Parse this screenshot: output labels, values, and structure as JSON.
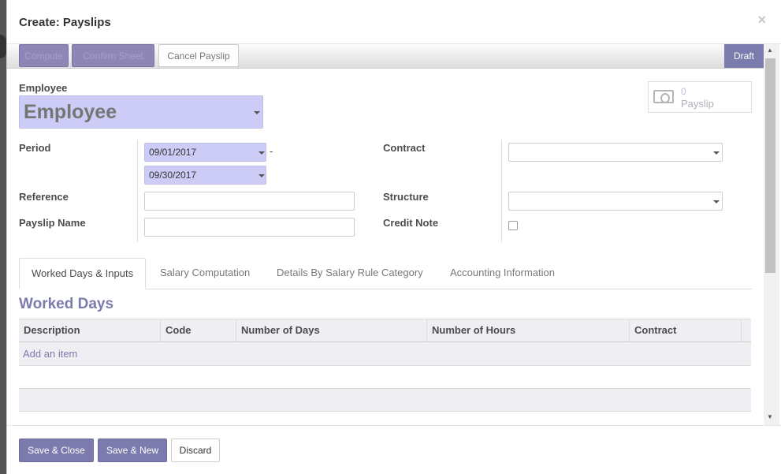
{
  "modal": {
    "title": "Create: Payslips",
    "close_glyph": "×"
  },
  "statusbar": {
    "buttons": [
      {
        "label": "Compute",
        "style": "primary"
      },
      {
        "label": "Confirm Sheet",
        "style": "primary"
      },
      {
        "label": "Cancel Payslip",
        "style": "default"
      }
    ],
    "status": "Draft"
  },
  "smart_button": {
    "icon": "money-icon",
    "count": "0",
    "label": "Payslip"
  },
  "form": {
    "employee_label": "Employee",
    "employee_value": "Employee",
    "period_label": "Period",
    "date_from": "09/01/2017",
    "date_sep": "-",
    "date_to": "09/30/2017",
    "reference_label": "Reference",
    "reference_value": "",
    "payslip_name_label": "Payslip Name",
    "payslip_name_value": "",
    "contract_label": "Contract",
    "contract_value": "",
    "structure_label": "Structure",
    "structure_value": "",
    "credit_note_label": "Credit Note",
    "credit_note_checked": false
  },
  "tabs": [
    {
      "label": "Worked Days & Inputs",
      "active": true
    },
    {
      "label": "Salary Computation",
      "active": false
    },
    {
      "label": "Details By Salary Rule Category",
      "active": false
    },
    {
      "label": "Accounting Information",
      "active": false
    }
  ],
  "worked_days": {
    "title": "Worked Days",
    "columns": [
      "Description",
      "Code",
      "Number of Days",
      "Number of Hours",
      "Contract"
    ],
    "add_item": "Add an item"
  },
  "footer": {
    "save_close": "Save & Close",
    "save_new": "Save & New",
    "discard": "Discard"
  },
  "colors": {
    "brand": "#7c7bad",
    "required_field": "#ccccf6"
  }
}
